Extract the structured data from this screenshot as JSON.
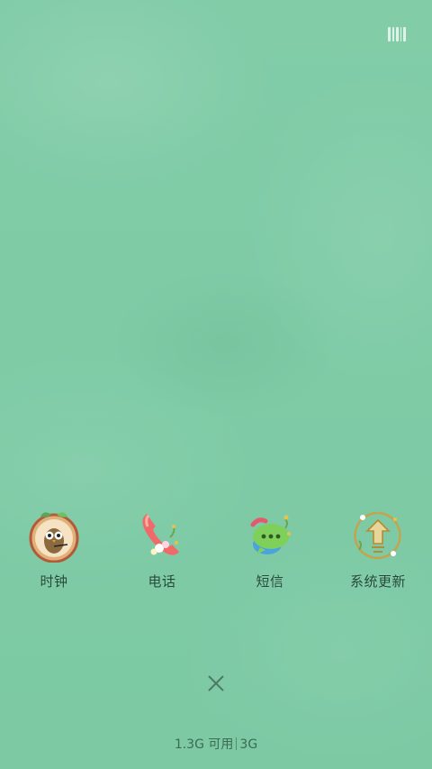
{
  "overlay": {
    "menu_icon": "barcode-menu-icon"
  },
  "apps": [
    {
      "label": "时钟",
      "icon": "clock-icon"
    },
    {
      "label": "电话",
      "icon": "phone-icon"
    },
    {
      "label": "短信",
      "icon": "messages-icon"
    },
    {
      "label": "系统更新",
      "icon": "system-update-icon"
    }
  ],
  "close": {
    "icon": "close-icon",
    "symbol": "×"
  },
  "memory": {
    "available": "1.3G 可用",
    "total": "3G"
  },
  "colors": {
    "wallpaper": "#7fcba6",
    "label": "#234a36",
    "memory_text": "#3b6b53"
  }
}
